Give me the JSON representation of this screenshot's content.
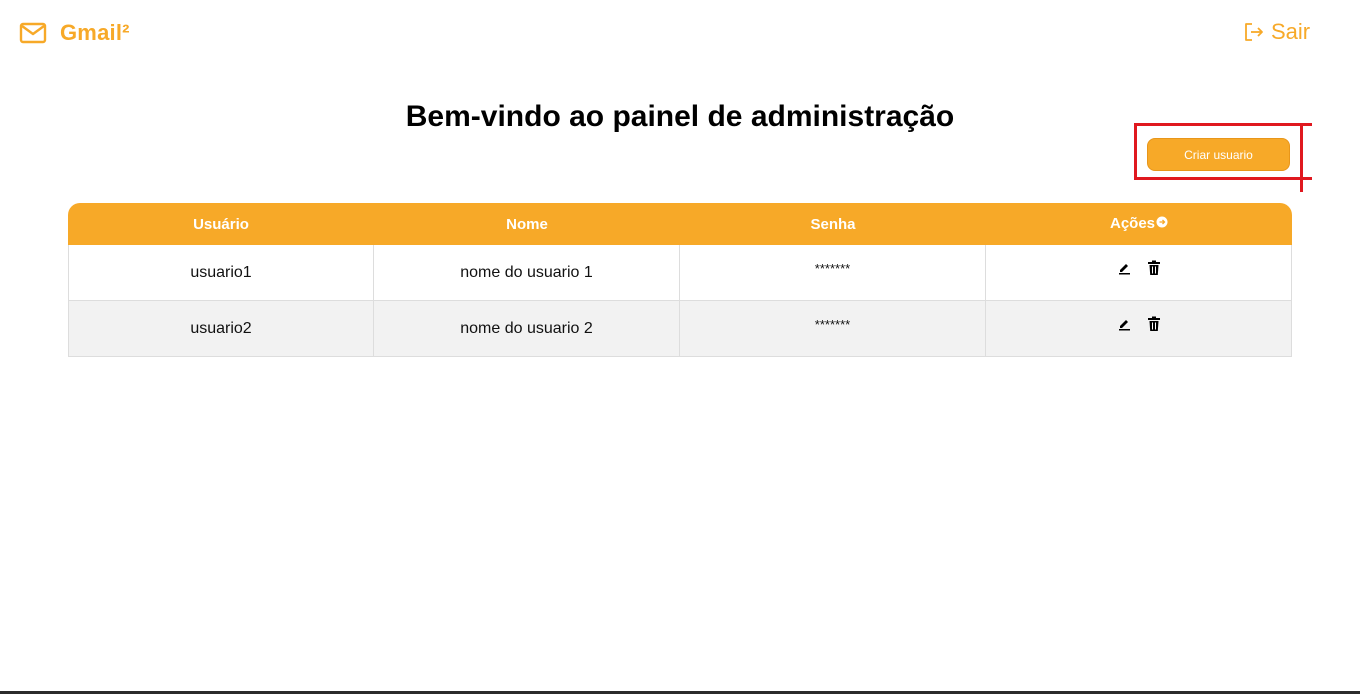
{
  "brand": {
    "name": "Gmail²",
    "icon": "mail-icon"
  },
  "header": {
    "logout_label": "Sair",
    "logout_icon": "logout-icon"
  },
  "page_title": "Bem-vindo ao painel de administração",
  "create_button_label": "Criar usuario",
  "table": {
    "columns": [
      "Usuário",
      "Nome",
      "Senha",
      "Ações"
    ],
    "rows": [
      {
        "usuario": "usuario1",
        "nome": "nome do usuario 1",
        "senha": "*******"
      },
      {
        "usuario": "usuario2",
        "nome": "nome do usuario 2",
        "senha": "*******"
      }
    ]
  },
  "colors": {
    "accent": "#f7a928",
    "annotation": "#e0181f",
    "row_alt": "#f2f2f2"
  }
}
